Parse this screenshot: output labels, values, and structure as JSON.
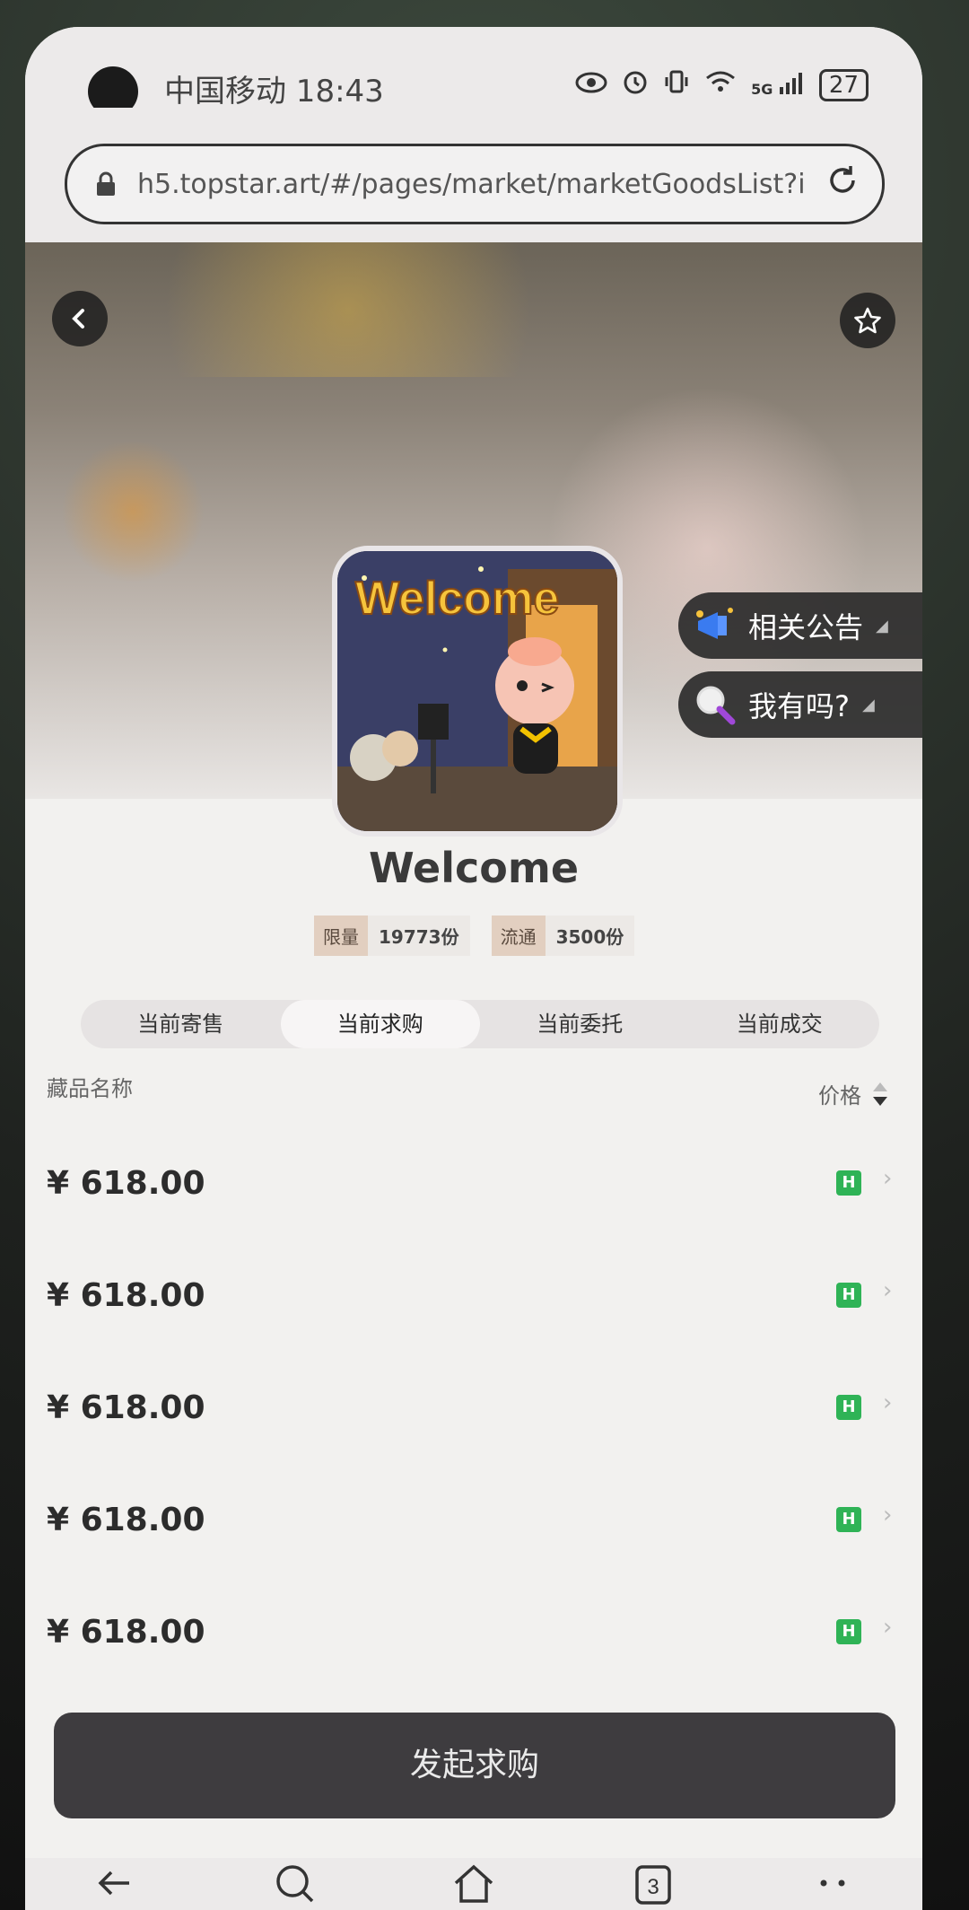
{
  "status_bar": {
    "carrier_time": "中国移动 18:43",
    "network": "5G",
    "battery": "27"
  },
  "browser": {
    "url": "h5.topstar.art/#/pages/market/marketGoodsList?i"
  },
  "side_actions": {
    "announcement": "相关公告",
    "do_i_have": "我有吗?"
  },
  "collection": {
    "title": "Welcome",
    "artwork_text": "Welcome",
    "limit_label": "限量",
    "limit_value": "19773份",
    "circulation_label": "流通",
    "circulation_value": "3500份"
  },
  "tabs": [
    {
      "label": "当前寄售",
      "active": false
    },
    {
      "label": "当前求购",
      "active": true
    },
    {
      "label": "当前委托",
      "active": false
    },
    {
      "label": "当前成交",
      "active": false
    }
  ],
  "list": {
    "name_header": "藏品名称",
    "price_header": "价格",
    "rows": [
      {
        "price": "¥ 618.00",
        "badge": "H"
      },
      {
        "price": "¥ 618.00",
        "badge": "H"
      },
      {
        "price": "¥ 618.00",
        "badge": "H"
      },
      {
        "price": "¥ 618.00",
        "badge": "H"
      },
      {
        "price": "¥ 618.00",
        "badge": "H"
      }
    ]
  },
  "cta": {
    "label": "发起求购"
  },
  "bottom_nav": {
    "tab_count": "3"
  },
  "colors": {
    "accent_badge": "#2fb356",
    "cta_bg": "#3e3c3f"
  }
}
